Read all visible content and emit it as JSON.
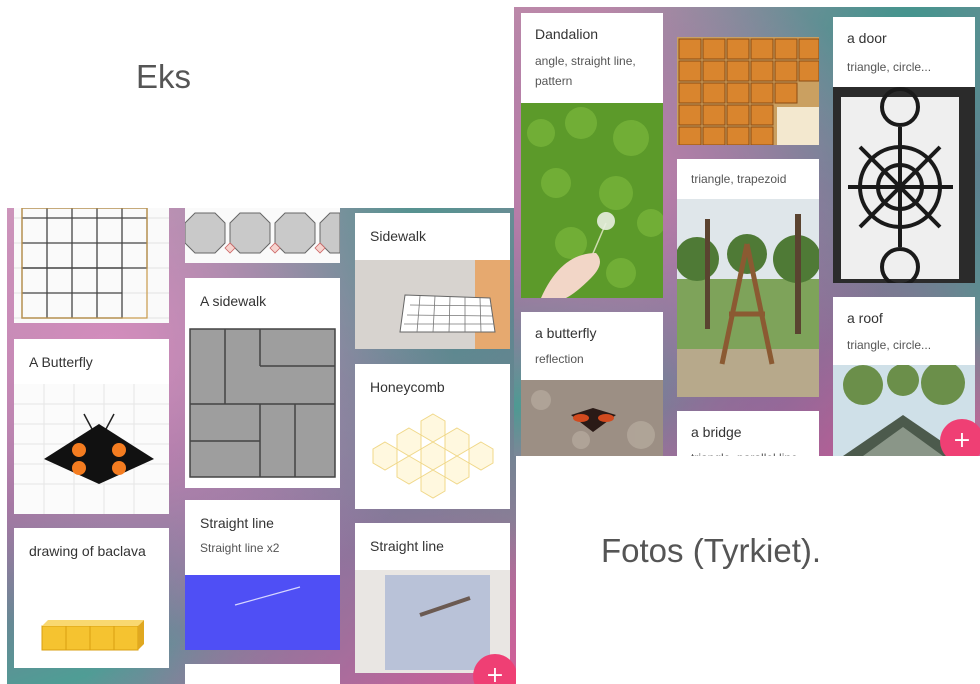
{
  "captions": {
    "left": "Eks",
    "right": "Fotos (Tyrkiet)."
  },
  "left_board": {
    "cards": {
      "butterfly": {
        "title": "A Butterfly"
      },
      "baclava": {
        "title": "drawing of baclava"
      },
      "sidewalk_a": {
        "title": "A sidewalk"
      },
      "straight_line_a": {
        "title": "Straight line",
        "subtitle": "Straight line x2"
      },
      "sidewalk": {
        "title": "Sidewalk"
      },
      "honeycomb": {
        "title": "Honeycomb"
      },
      "straight_line_b": {
        "title": "Straight line"
      }
    },
    "fab_label": "+"
  },
  "right_board": {
    "cards": {
      "dandelion": {
        "title": "Dandalion",
        "subtitle": "angle, straight line, pattern"
      },
      "butterfly": {
        "title": "a butterfly",
        "subtitle": "reflection"
      },
      "swing": {
        "subtitle": "triangle, trapezoid"
      },
      "bridge": {
        "title": "a bridge",
        "subtitle": "triangle, parallel line"
      },
      "door": {
        "title": "a door",
        "subtitle": "triangle, circle..."
      },
      "roof": {
        "title": "a roof",
        "subtitle": "triangle, circle..."
      }
    },
    "fab_label": "+"
  },
  "colors": {
    "accent_fab": "#ef3f74",
    "card_bg": "#ffffff",
    "caption": "#555555"
  }
}
